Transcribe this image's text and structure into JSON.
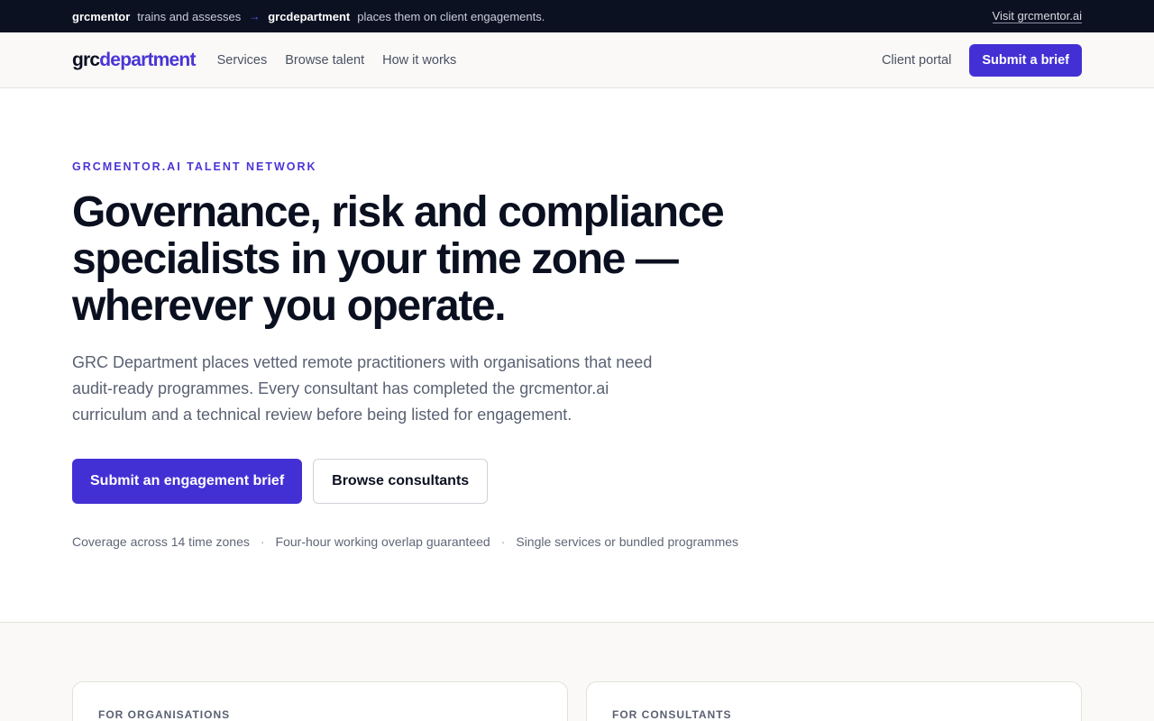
{
  "topbar": {
    "brand1": "grcmentor",
    "text1": "trains and assesses",
    "arrow": "→",
    "brand2": "grcdepartment",
    "text2": "places them on client engagements.",
    "visit_link": "Visit grcmentor.ai"
  },
  "nav": {
    "logo_part1": "grc",
    "logo_part2": "department",
    "links": [
      "Services",
      "Browse talent",
      "How it works"
    ],
    "client_portal": "Client portal",
    "cta": "Submit a brief"
  },
  "hero": {
    "eyebrow": "GRCMENTOR.AI TALENT NETWORK",
    "title": "Governance, risk and compliance specialists in your time zone — wherever you operate.",
    "lead": "GRC Department places vetted remote practitioners with organisations that need audit-ready programmes. Every consultant has completed the grcmentor.ai curriculum and a technical review before being listed for engagement.",
    "primary_cta": "Submit an engagement brief",
    "secondary_cta": "Browse consultants",
    "trust": [
      "Coverage across 14 time zones",
      "Four-hour working overlap guaranteed",
      "Single services or bundled programmes"
    ],
    "separator": "·"
  },
  "cards": [
    {
      "label": "FOR ORGANISATIONS"
    },
    {
      "label": "FOR CONSULTANTS"
    }
  ],
  "colors": {
    "accent": "#4330d4",
    "topbar_bg": "#0b1121",
    "text_dark": "#0b1020"
  }
}
